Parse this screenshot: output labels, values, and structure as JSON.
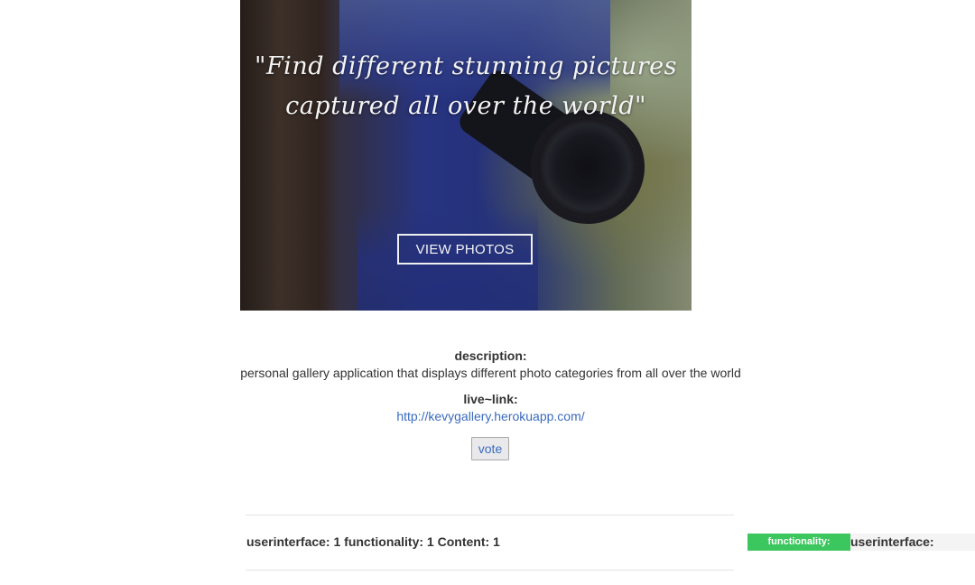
{
  "hero": {
    "quote_line1": "\"Find different stunning pictures",
    "quote_line2": "captured all over the world\"",
    "button_label": "VIEW PHOTOS"
  },
  "details": {
    "description_label": "description:",
    "description_text": "personal gallery application that displays different photo categories from all over the world",
    "live_link_label": "live~link:",
    "live_link_url": "http://kevygallery.herokuapp.com/",
    "vote_label": "vote"
  },
  "ratings": {
    "summary": "userinterface: 1 functionality: 1 Content: 1",
    "tag_functionality": "functionality:",
    "tag_userinterface": "userinterface:"
  },
  "colors": {
    "link": "#3b6bbd",
    "tag_green": "#3cc65e"
  }
}
